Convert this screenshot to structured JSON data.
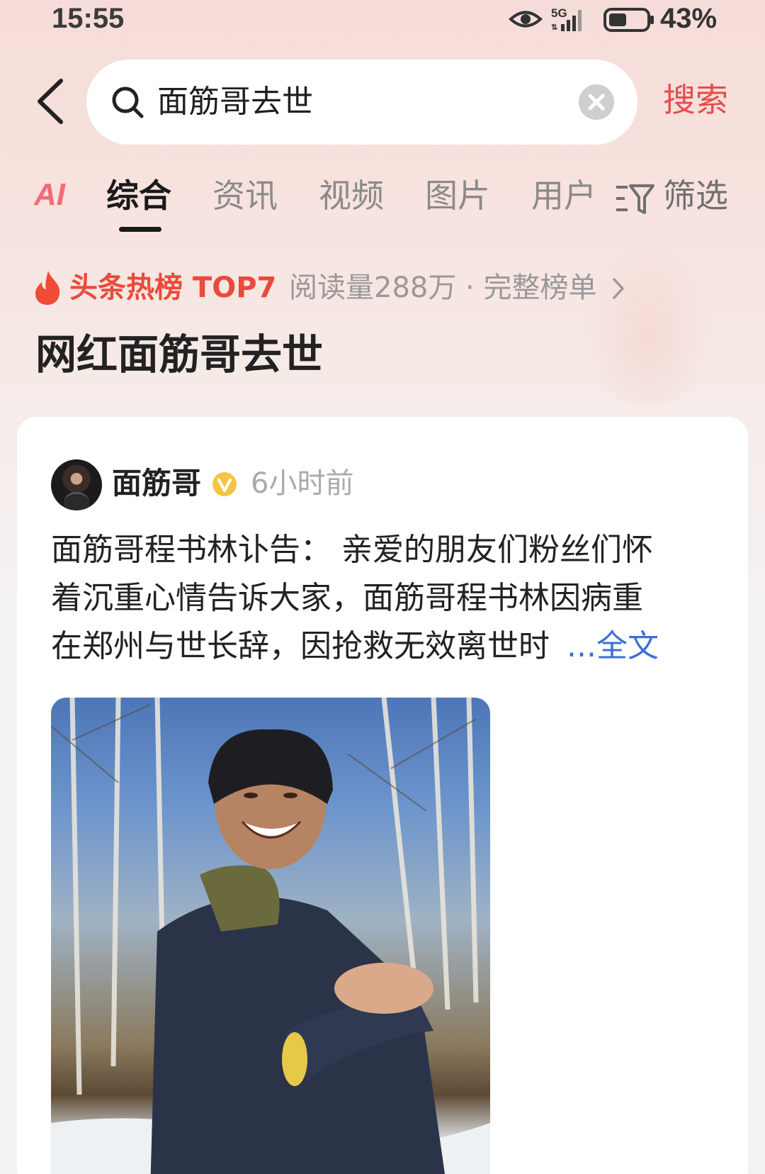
{
  "status_bar": {
    "time": "15:55",
    "network": "5G",
    "battery": "43%"
  },
  "search": {
    "query": "面筋哥去世",
    "button_label": "搜索"
  },
  "tabs": {
    "ai_label": "AI",
    "items": [
      {
        "label": "综合",
        "active": true
      },
      {
        "label": "资讯",
        "active": false
      },
      {
        "label": "视频",
        "active": false
      },
      {
        "label": "图片",
        "active": false
      },
      {
        "label": "用户",
        "active": false
      }
    ],
    "filter_label": "筛选"
  },
  "hot_list": {
    "label": "头条热榜 TOP7",
    "meta": "阅读量288万 · 完整榜单"
  },
  "topic_title": "网红面筋哥去世",
  "post": {
    "author": "面筋哥",
    "time": "6小时前",
    "text_lines": [
      "面筋哥程书林讣告：  亲爱的朋友们粉丝们怀",
      "着沉重心情告诉大家，面筋哥程书林因病重",
      "在郑州与世长辞，因抢救无效离世时"
    ],
    "more_label": "...全文"
  },
  "colors": {
    "accent": "#e44d4d",
    "link": "#3d6fd6",
    "hot": "#ea4a3c",
    "background_top": "#f6dcd8"
  },
  "icons": [
    "eye-icon",
    "signal-icon",
    "battery-icon",
    "back-icon",
    "search-icon",
    "clear-icon",
    "filter-icon",
    "fire-icon",
    "chevron-right-icon",
    "verified-icon"
  ]
}
